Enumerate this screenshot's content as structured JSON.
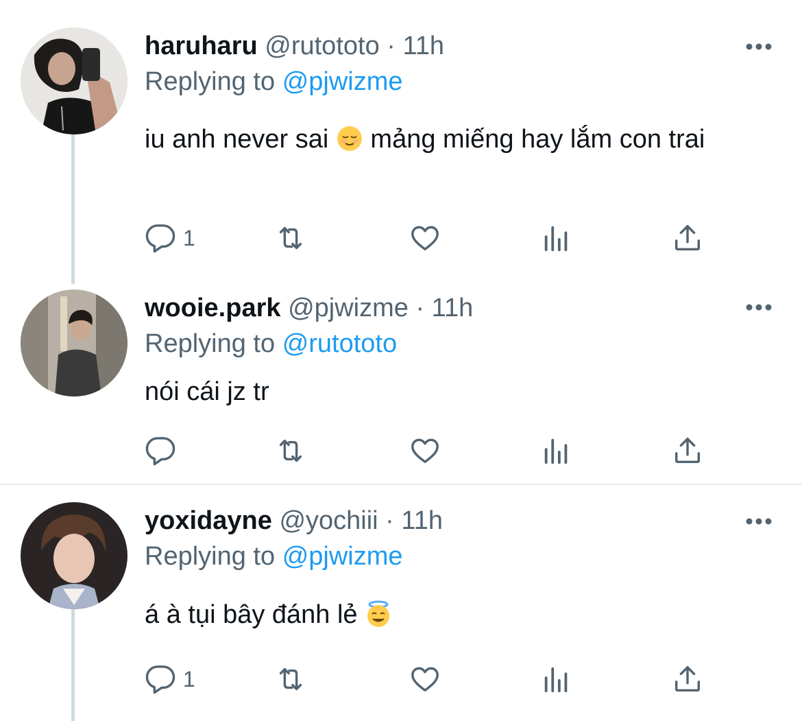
{
  "tweets": [
    {
      "name": "haruharu",
      "handle": "@rutototo",
      "dot": "·",
      "time": "11h",
      "replying_prefix": "Replying to",
      "replying_to": "@pjwizme",
      "text_before": "iu anh never sai",
      "text_after": "mảng miếng hay lắm con trai",
      "emoji": "relieved-face",
      "reply_count": "1",
      "avatar": "person-holding-phone-selfie"
    },
    {
      "name": "wooie.park",
      "handle": "@pjwizme",
      "dot": "·",
      "time": "11h",
      "replying_prefix": "Replying to",
      "replying_to": "@rutototo",
      "text": "nói cái jz tr",
      "reply_count": "",
      "avatar": "person-in-jacket"
    },
    {
      "name": "yoxidayne",
      "handle": "@yochiii",
      "dot": "·",
      "time": "11h",
      "replying_prefix": "Replying to",
      "replying_to": "@pjwizme",
      "text": "á à tụi bây đánh lẻ",
      "emoji": "smiling-face-with-halo",
      "reply_count": "1",
      "avatar": "person-portrait"
    }
  ],
  "colors": {
    "link": "#1d9bf0",
    "secondary": "#536471",
    "thread_line": "#cfd9de"
  }
}
